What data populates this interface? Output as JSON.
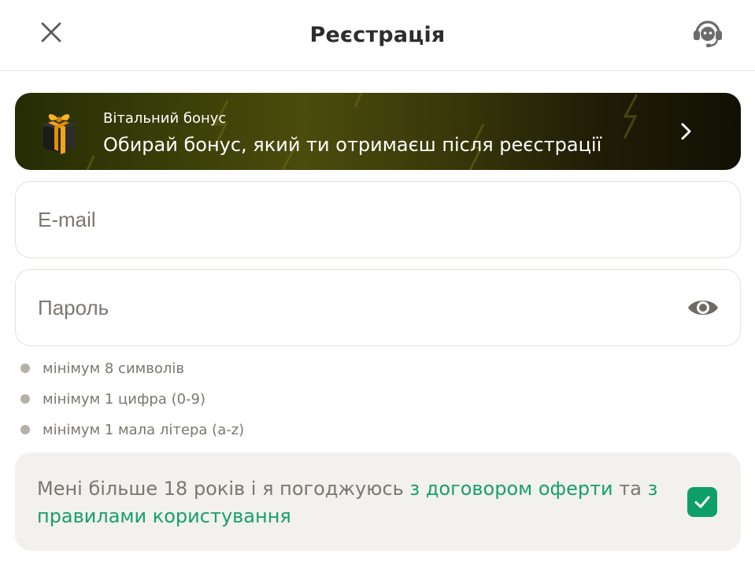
{
  "header": {
    "title": "Реєстрація",
    "close_icon": "close-icon",
    "support_icon": "headset-icon"
  },
  "bonus": {
    "label": "Вітальний бонус",
    "text": "Обирай бонус, який ти отримаєш після реєстрації",
    "icon": "gift-icon",
    "arrow_icon": "chevron-right-icon"
  },
  "form": {
    "email_placeholder": "E-mail",
    "email_value": "",
    "password_placeholder": "Пароль",
    "password_value": "",
    "password_toggle_icon": "eye-icon"
  },
  "password_rules": [
    "мінімум 8 символів",
    "мінімум 1 цифра (0-9)",
    "мінімум 1 мала літера (a-z)"
  ],
  "agreement": {
    "text_before": "Мені більше 18 років і я погоджуюсь ",
    "offer_link": "з договором оферти",
    "text_middle": " та ",
    "rules_link": "з правилами користування",
    "checked": true
  },
  "colors": {
    "accent_green": "#0e9f68",
    "link_green": "#17a06a",
    "muted_text": "#7b776f",
    "banner_dark": "#252c05"
  }
}
